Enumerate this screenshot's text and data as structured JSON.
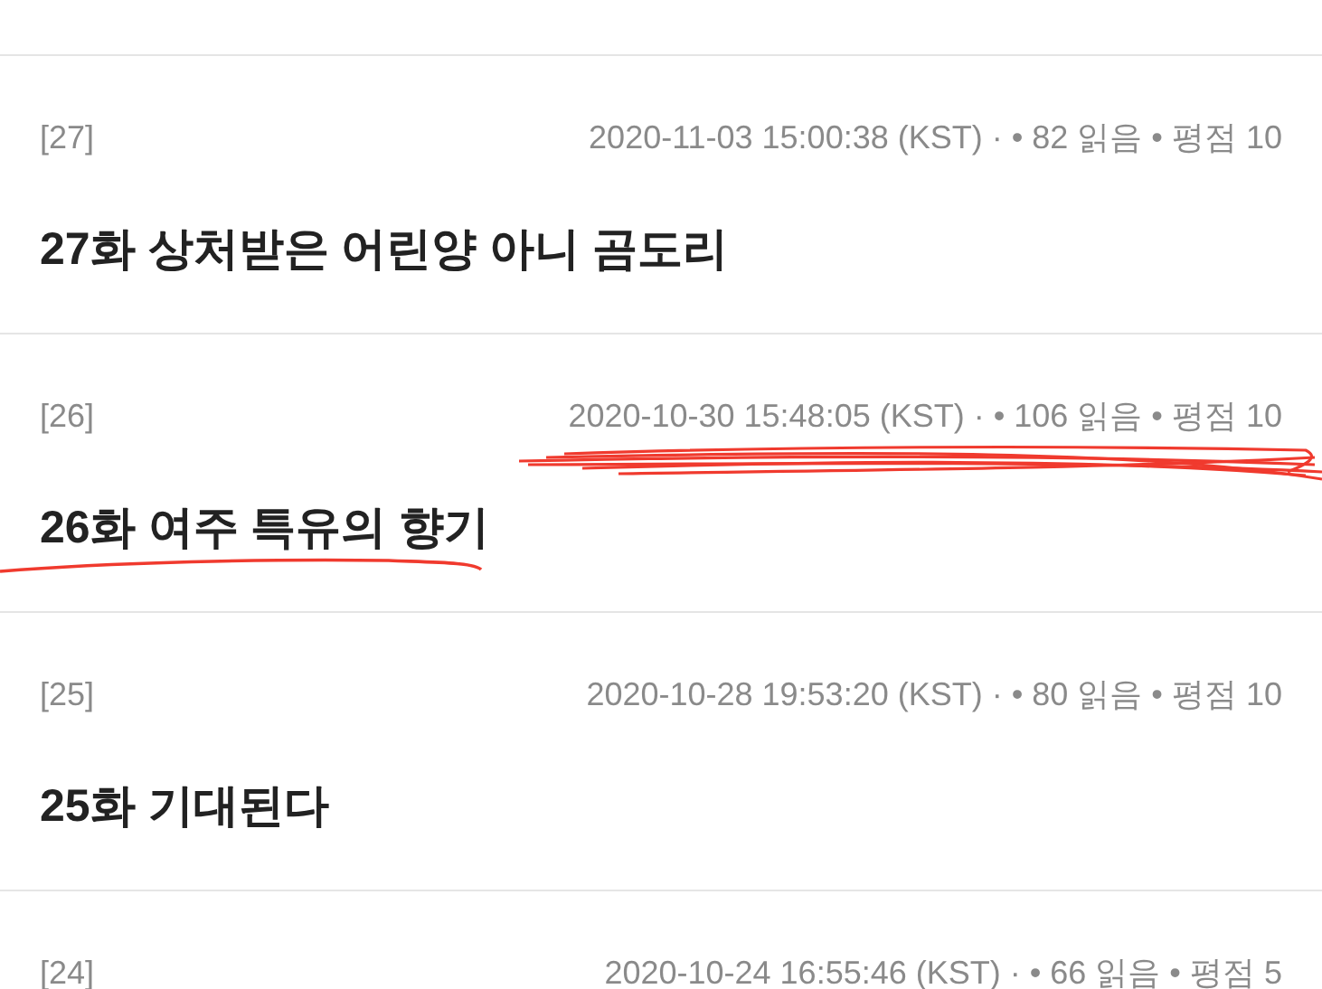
{
  "episodes": [
    {
      "number": "[27]",
      "meta": "2020-11-03 15:00:38 (KST) · • 82 읽음 • 평점 10",
      "title": "27화 상처받은 어린양 아니 곰도리",
      "scribbled": false
    },
    {
      "number": "[26]",
      "meta": "2020-10-30 15:48:05 (KST) · • 106 읽음 • 평점 10",
      "title": "26화 여주 특유의 향기",
      "scribbled": true
    },
    {
      "number": "[25]",
      "meta": "2020-10-28 19:53:20 (KST) · • 80 읽음 • 평점 10",
      "title": "25화 기대된다",
      "scribbled": false
    },
    {
      "number": "[24]",
      "meta": "2020-10-24 16:55:46 (KST) · • 66 읽음 • 평점 5"
    }
  ]
}
